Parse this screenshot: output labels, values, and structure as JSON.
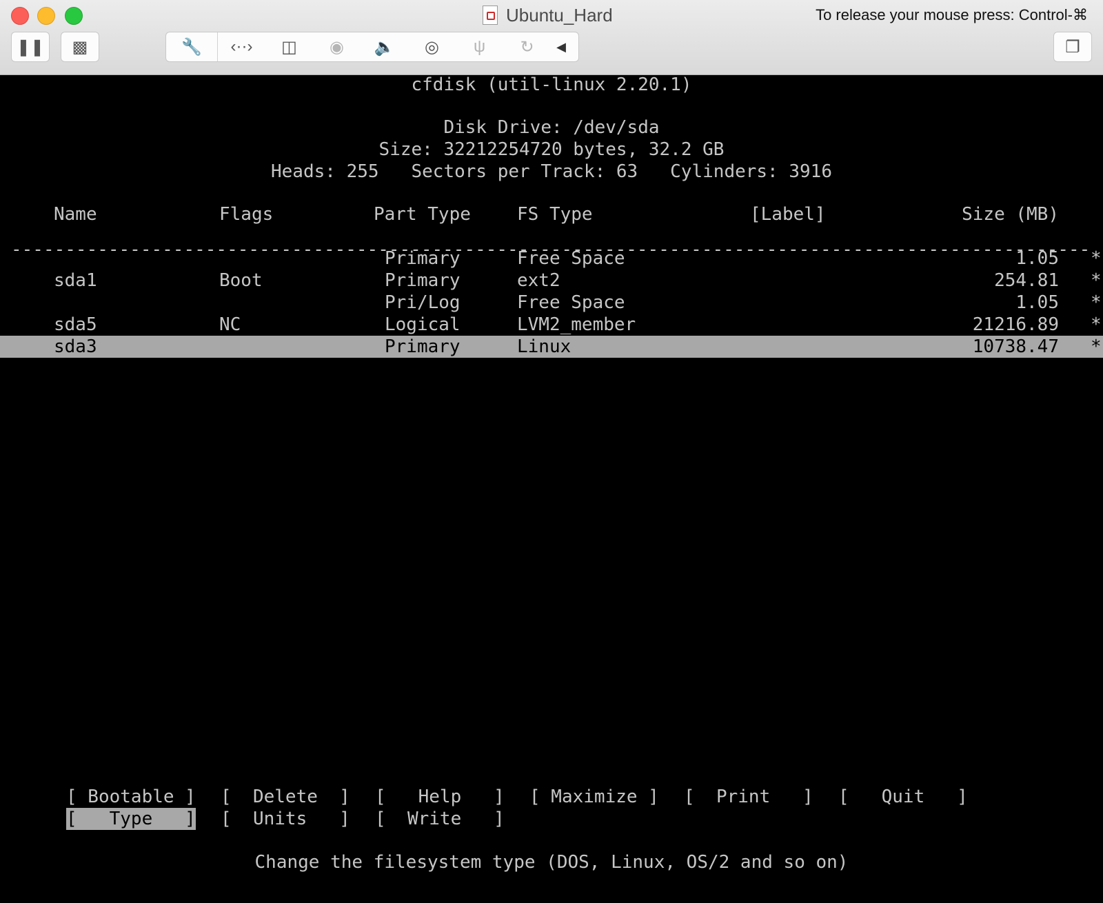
{
  "window": {
    "title": "Ubuntu_Hard",
    "release_hint": "To release your mouse press: Control-⌘"
  },
  "toolbar": {
    "icons": [
      "pause-icon",
      "snapshot-icon",
      "settings-wrench-icon",
      "network-icon",
      "hard-disk-icon",
      "optical-drive-icon",
      "sound-icon",
      "camera-icon",
      "usb-icon",
      "sharing-icon",
      "collapse-arrow-icon",
      "fullscreen-icon"
    ]
  },
  "cfdisk": {
    "header": "cfdisk (util-linux 2.20.1)",
    "disk_drive": "Disk Drive: /dev/sda",
    "size_line": "Size: 32212254720 bytes, 32.2 GB",
    "geometry_line": "Heads: 255   Sectors per Track: 63   Cylinders: 3916",
    "columns": {
      "name": "Name",
      "flags": "Flags",
      "part_type": "Part Type",
      "fs_type": "FS Type",
      "label": "[Label]",
      "size": "Size (MB)"
    },
    "rule": "------------------------------------------------------------------------------------------------------------------------",
    "partitions": [
      {
        "name": "",
        "flags": "",
        "part_type": "Primary",
        "fs_type": "Free Space",
        "label": "",
        "size": "1.05",
        "marker": "*"
      },
      {
        "name": "sda1",
        "flags": "Boot",
        "part_type": "Primary",
        "fs_type": "ext2",
        "label": "",
        "size": "254.81",
        "marker": "*"
      },
      {
        "name": "",
        "flags": "",
        "part_type": "Pri/Log",
        "fs_type": "Free Space",
        "label": "",
        "size": "1.05",
        "marker": "*"
      },
      {
        "name": "sda5",
        "flags": "NC",
        "part_type": "Logical",
        "fs_type": "LVM2_member",
        "label": "",
        "size": "21216.89",
        "marker": "*"
      },
      {
        "name": "sda3",
        "flags": "",
        "part_type": "Primary",
        "fs_type": "Linux",
        "label": "",
        "size": "10738.47",
        "marker": "*"
      }
    ],
    "selected_row": 4,
    "menu": {
      "bootable": "[ Bootable ]",
      "delete": "[  Delete  ]",
      "help": "[   Help   ]",
      "maximize": "[ Maximize ]",
      "print": "[  Print   ]",
      "quit": "[   Quit   ]",
      "type": "[   Type   ]",
      "units": "[  Units   ]",
      "write": "[  Write   ]"
    },
    "status": "Change the filesystem type (DOS, Linux, OS/2 and so on)"
  }
}
